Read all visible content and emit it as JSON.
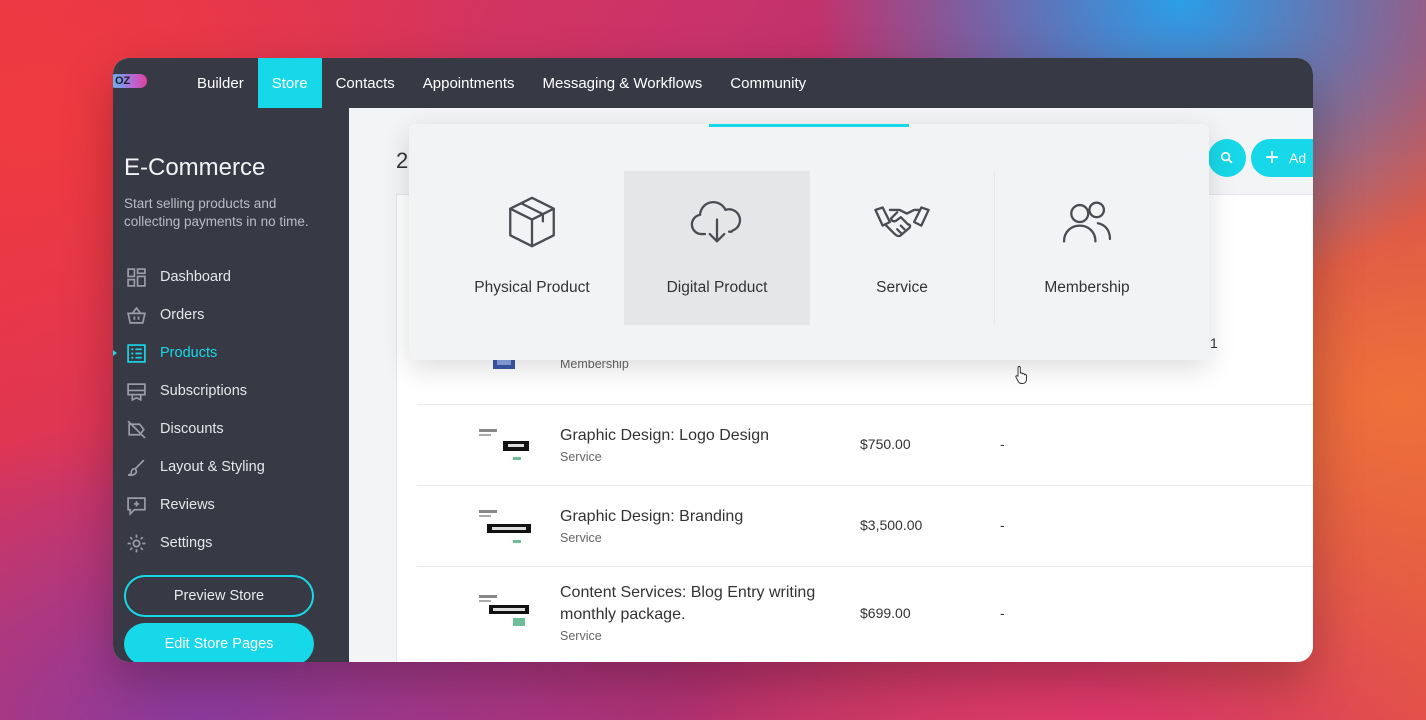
{
  "topbar": {
    "logo_text": "OZ",
    "nav": [
      {
        "label": "Builder",
        "active": false
      },
      {
        "label": "Store",
        "active": true
      },
      {
        "label": "Contacts",
        "active": false
      },
      {
        "label": "Appointments",
        "active": false
      },
      {
        "label": "Messaging & Workflows",
        "active": false
      },
      {
        "label": "Community",
        "active": false
      }
    ]
  },
  "sidebar": {
    "title": "E-Commerce",
    "subtitle": "Start selling products and collecting payments in no time.",
    "items": [
      {
        "label": "Dashboard",
        "icon": "dashboard-icon"
      },
      {
        "label": "Orders",
        "icon": "basket-icon"
      },
      {
        "label": "Products",
        "icon": "list-icon",
        "active": true
      },
      {
        "label": "Subscriptions",
        "icon": "subscriptions-icon"
      },
      {
        "label": "Discounts",
        "icon": "tag-icon"
      },
      {
        "label": "Layout & Styling",
        "icon": "brush-icon"
      },
      {
        "label": "Reviews",
        "icon": "review-icon"
      },
      {
        "label": "Settings",
        "icon": "gear-icon"
      }
    ],
    "preview_label": "Preview Store",
    "edit_label": "Edit Store Pages"
  },
  "main": {
    "page_number": "2",
    "add_label": "Ad",
    "products": [
      {
        "name": "",
        "type": "Membership",
        "price": "",
        "dash": "",
        "count": "1"
      },
      {
        "name": "Graphic Design: Logo Design",
        "type": "Service",
        "price": "$750.00",
        "dash": "-"
      },
      {
        "name": "Graphic Design: Branding",
        "type": "Service",
        "price": "$3,500.00",
        "dash": "-"
      },
      {
        "name": "Content Services: Blog Entry writing monthly package.",
        "type": "Service",
        "price": "$699.00",
        "dash": "-"
      }
    ]
  },
  "dropdown": {
    "options": [
      {
        "label": "Physical Product",
        "icon": "box-icon"
      },
      {
        "label": "Digital Product",
        "icon": "cloud-download-icon",
        "hover": true
      },
      {
        "label": "Service",
        "icon": "handshake-icon"
      },
      {
        "label": "Membership",
        "icon": "users-icon"
      }
    ]
  },
  "colors": {
    "accent": "#17d8e8",
    "sidebar_bg": "#373a45"
  }
}
